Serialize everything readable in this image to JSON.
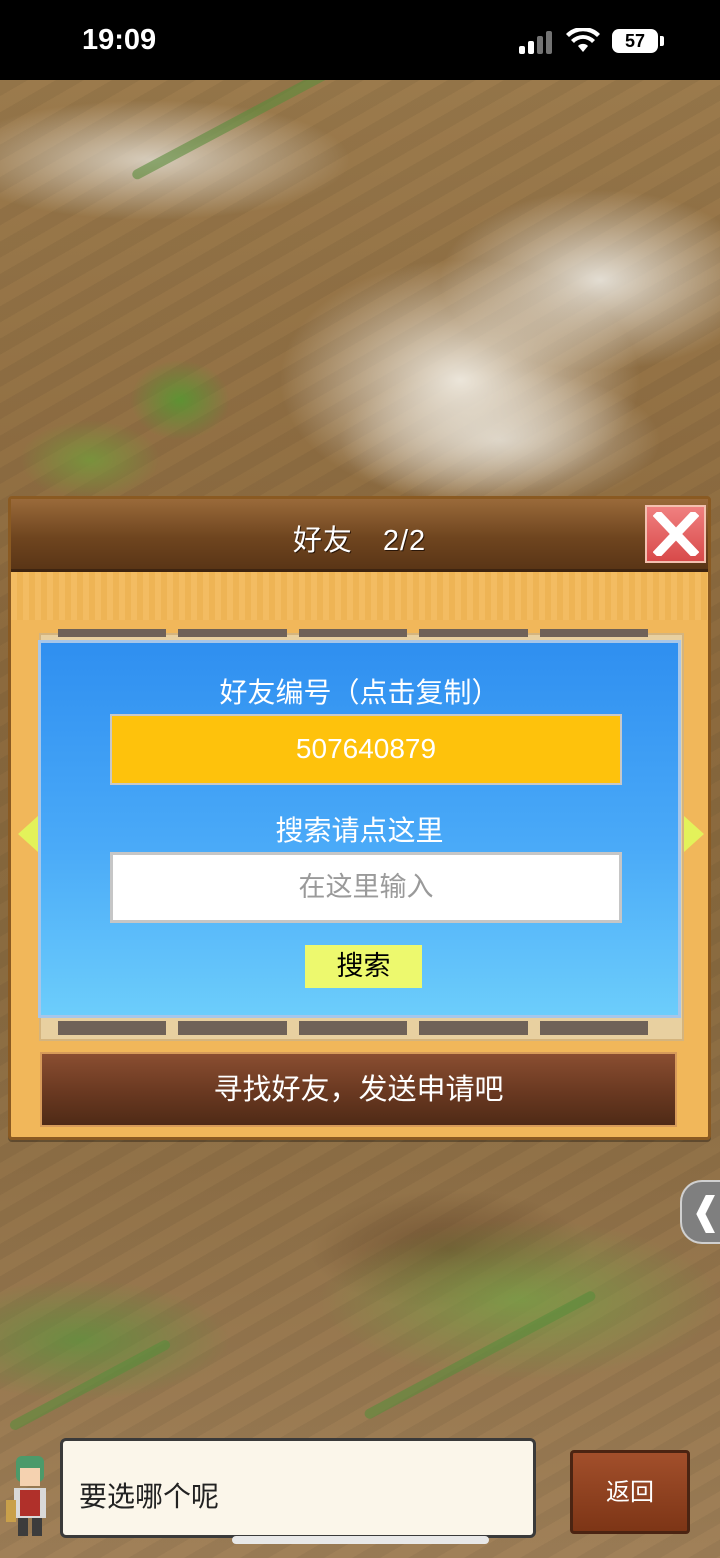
{
  "status_bar": {
    "time": "19:09",
    "battery": "57"
  },
  "dialog": {
    "title": "好友　2/2",
    "friend_id_label": "好友编号（点击复制）",
    "friend_id": "507640879",
    "search_label": "搜索请点这里",
    "search_placeholder": "在这里输入",
    "search_button": "搜索",
    "send_request": "寻找好友，发送申请吧"
  },
  "side_tab": {
    "glyph": "❰"
  },
  "message": {
    "text": "要选哪个呢"
  },
  "back_button": "返回",
  "icons": [
    "close-icon",
    "arrow-left-icon",
    "arrow-right-icon",
    "signal-icon",
    "wifi-icon",
    "battery-icon"
  ]
}
